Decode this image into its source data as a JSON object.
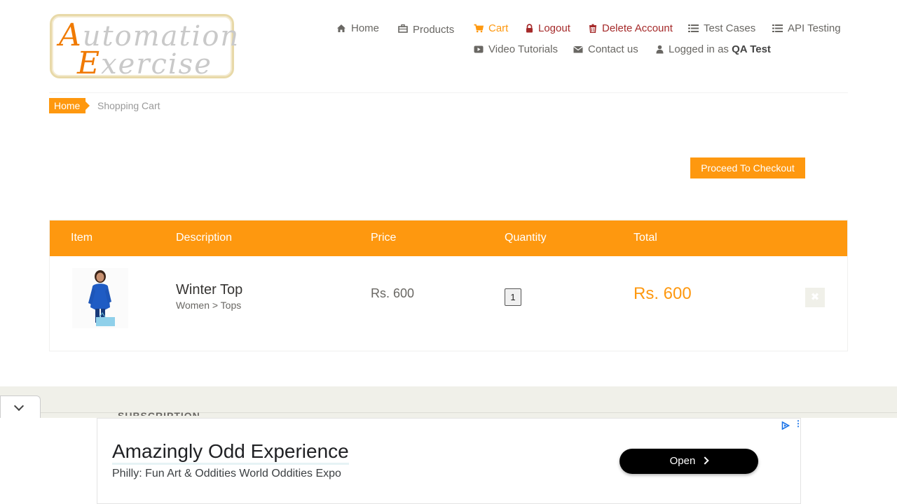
{
  "logo": {
    "line1_cap": "A",
    "line1_rest": "utomation",
    "line2_cap": "E",
    "line2_rest": "xercise"
  },
  "nav": {
    "home": {
      "label": "Home",
      "icon": "home-icon"
    },
    "products": {
      "label": "Products",
      "icon": "briefcase-icon"
    },
    "cart": {
      "label": "Cart",
      "icon": "shopping-cart-icon"
    },
    "logout": {
      "label": "Logout",
      "icon": "lock-icon"
    },
    "delete_account": {
      "label": "Delete Account",
      "icon": "trash-icon"
    },
    "test_cases": {
      "label": "Test Cases",
      "icon": "list-icon"
    },
    "api_testing": {
      "label": "API Testing",
      "icon": "list-icon"
    },
    "video_tutorials": {
      "label": "Video Tutorials",
      "icon": "youtube-play-icon"
    },
    "contact_us": {
      "label": "Contact us",
      "icon": "envelope-icon"
    },
    "logged_in_prefix": "Logged in as",
    "logged_in_user": "QA Test"
  },
  "breadcrumb": {
    "home": "Home",
    "current": "Shopping Cart"
  },
  "checkout_button": "Proceed To Checkout",
  "cart_table": {
    "headers": {
      "item": "Item",
      "description": "Description",
      "price": "Price",
      "quantity": "Quantity",
      "total": "Total"
    },
    "rows": [
      {
        "name": "Winter Top",
        "category": "Women > Tops",
        "price": "Rs. 600",
        "quantity": "1",
        "total": "Rs. 600"
      }
    ]
  },
  "footer": {
    "subscription_heading": "SUBSCRIPTION"
  },
  "ad": {
    "title": "Amazingly Odd Experience",
    "subtitle": "Philly: Fun Art & Oddities World Oddities Expo",
    "button": "Open"
  },
  "colors": {
    "accent": "#fe980f",
    "danger": "#a52a2a",
    "footer_bg": "#f0f0e9",
    "text": "#696763"
  }
}
